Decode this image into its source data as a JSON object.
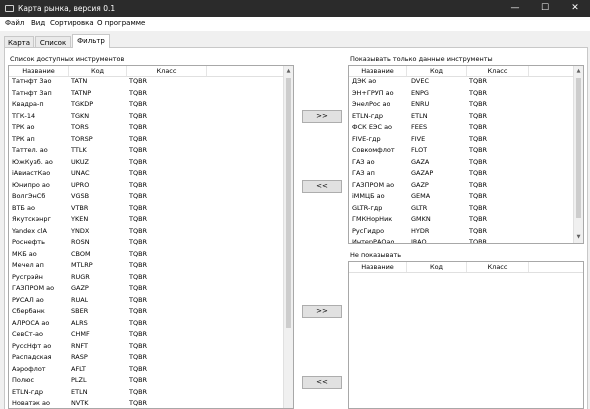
{
  "window": {
    "title": "Карта рынка, версия 0.1",
    "controls": {
      "minimize": "—",
      "maximize": "☐",
      "close": "✕"
    }
  },
  "menu": [
    "Файл",
    "Вид",
    "Сортировка",
    "О программе"
  ],
  "tabs": [
    {
      "label": "Карта",
      "active": false
    },
    {
      "label": "Список",
      "active": false
    },
    {
      "label": "Фильтр",
      "active": true
    }
  ],
  "available": {
    "title": "Список доступных инструментов",
    "columns": [
      "Название",
      "Код",
      "Класс"
    ],
    "rows": [
      [
        "Татнфт 3ао",
        "TATN",
        "TQBR"
      ],
      [
        "Татнфт 3ап",
        "TATNP",
        "TQBR"
      ],
      [
        "Квадра-п",
        "TGKDP",
        "TQBR"
      ],
      [
        "ТГК-14",
        "TGKN",
        "TQBR"
      ],
      [
        "ТРК ао",
        "TORS",
        "TQBR"
      ],
      [
        "ТРК ап",
        "TORSP",
        "TQBR"
      ],
      [
        "Таттел. ао",
        "TTLK",
        "TQBR"
      ],
      [
        "ЮжКузб. ао",
        "UKUZ",
        "TQBR"
      ],
      [
        "iАвиастКао",
        "UNAC",
        "TQBR"
      ],
      [
        "Юнипро ао",
        "UPRO",
        "TQBR"
      ],
      [
        "ВолгЭнСб",
        "VGSB",
        "TQBR"
      ],
      [
        "ВТБ ао",
        "VTBR",
        "TQBR"
      ],
      [
        "Якутскэнрг",
        "YKEN",
        "TQBR"
      ],
      [
        "Yandex clA",
        "YNDX",
        "TQBR"
      ],
      [
        "Роснефть",
        "ROSN",
        "TQBR"
      ],
      [
        "МКБ ао",
        "CBOM",
        "TQBR"
      ],
      [
        "Мечел ап",
        "MTLRP",
        "TQBR"
      ],
      [
        "Русгрэйн",
        "RUGR",
        "TQBR"
      ],
      [
        "ГАЗПРОМ ао",
        "GAZP",
        "TQBR"
      ],
      [
        "РУСАЛ ао",
        "RUAL",
        "TQBR"
      ],
      [
        "Сбербанк",
        "SBER",
        "TQBR"
      ],
      [
        "АЛРОСА ао",
        "ALRS",
        "TQBR"
      ],
      [
        "СевСт-ао",
        "CHMF",
        "TQBR"
      ],
      [
        "РуссНфт ао",
        "RNFT",
        "TQBR"
      ],
      [
        "Распадская",
        "RASP",
        "TQBR"
      ],
      [
        "Аэрофлот",
        "AFLT",
        "TQBR"
      ],
      [
        "Полюс",
        "PLZL",
        "TQBR"
      ],
      [
        "ETLN-гдр",
        "ETLN",
        "TQBR"
      ],
      [
        "Новатэк ао",
        "NVTK",
        "TQBR"
      ],
      [
        "НКНХ ап",
        "NKNCP",
        "TQBR"
      ]
    ]
  },
  "show_only": {
    "title": "Показывать только данные инструменты",
    "columns": [
      "Название",
      "Код",
      "Класс"
    ],
    "rows": [
      [
        "ДЭК ао",
        "DVEC",
        "TQBR"
      ],
      [
        "ЭН+ГРУП ао",
        "ENPG",
        "TQBR"
      ],
      [
        "ЭнелРос ао",
        "ENRU",
        "TQBR"
      ],
      [
        "ETLN-гдр",
        "ETLN",
        "TQBR"
      ],
      [
        "ФСК ЕЭС ао",
        "FEES",
        "TQBR"
      ],
      [
        "FIVE-гдр",
        "FIVE",
        "TQBR"
      ],
      [
        "Совкомфлот",
        "FLOT",
        "TQBR"
      ],
      [
        "ГАЗ ао",
        "GAZA",
        "TQBR"
      ],
      [
        "ГАЗ ап",
        "GAZAP",
        "TQBR"
      ],
      [
        "ГАЗПРОМ ао",
        "GAZP",
        "TQBR"
      ],
      [
        "iММЦБ ао",
        "GEMA",
        "TQBR"
      ],
      [
        "GLTR-гдр",
        "GLTR",
        "TQBR"
      ],
      [
        "ГМКНорНик",
        "GMKN",
        "TQBR"
      ],
      [
        "РусГидро",
        "HYDR",
        "TQBR"
      ],
      [
        "ИнтерРАОао",
        "IRAO",
        "TQBR"
      ]
    ]
  },
  "hide": {
    "title": "Не показывать",
    "columns": [
      "Название",
      "Код",
      "Класс"
    ],
    "rows": []
  },
  "buttons": {
    "add_show": ">>",
    "remove_show": "<<",
    "add_hide": ">>",
    "remove_hide": "<<"
  }
}
